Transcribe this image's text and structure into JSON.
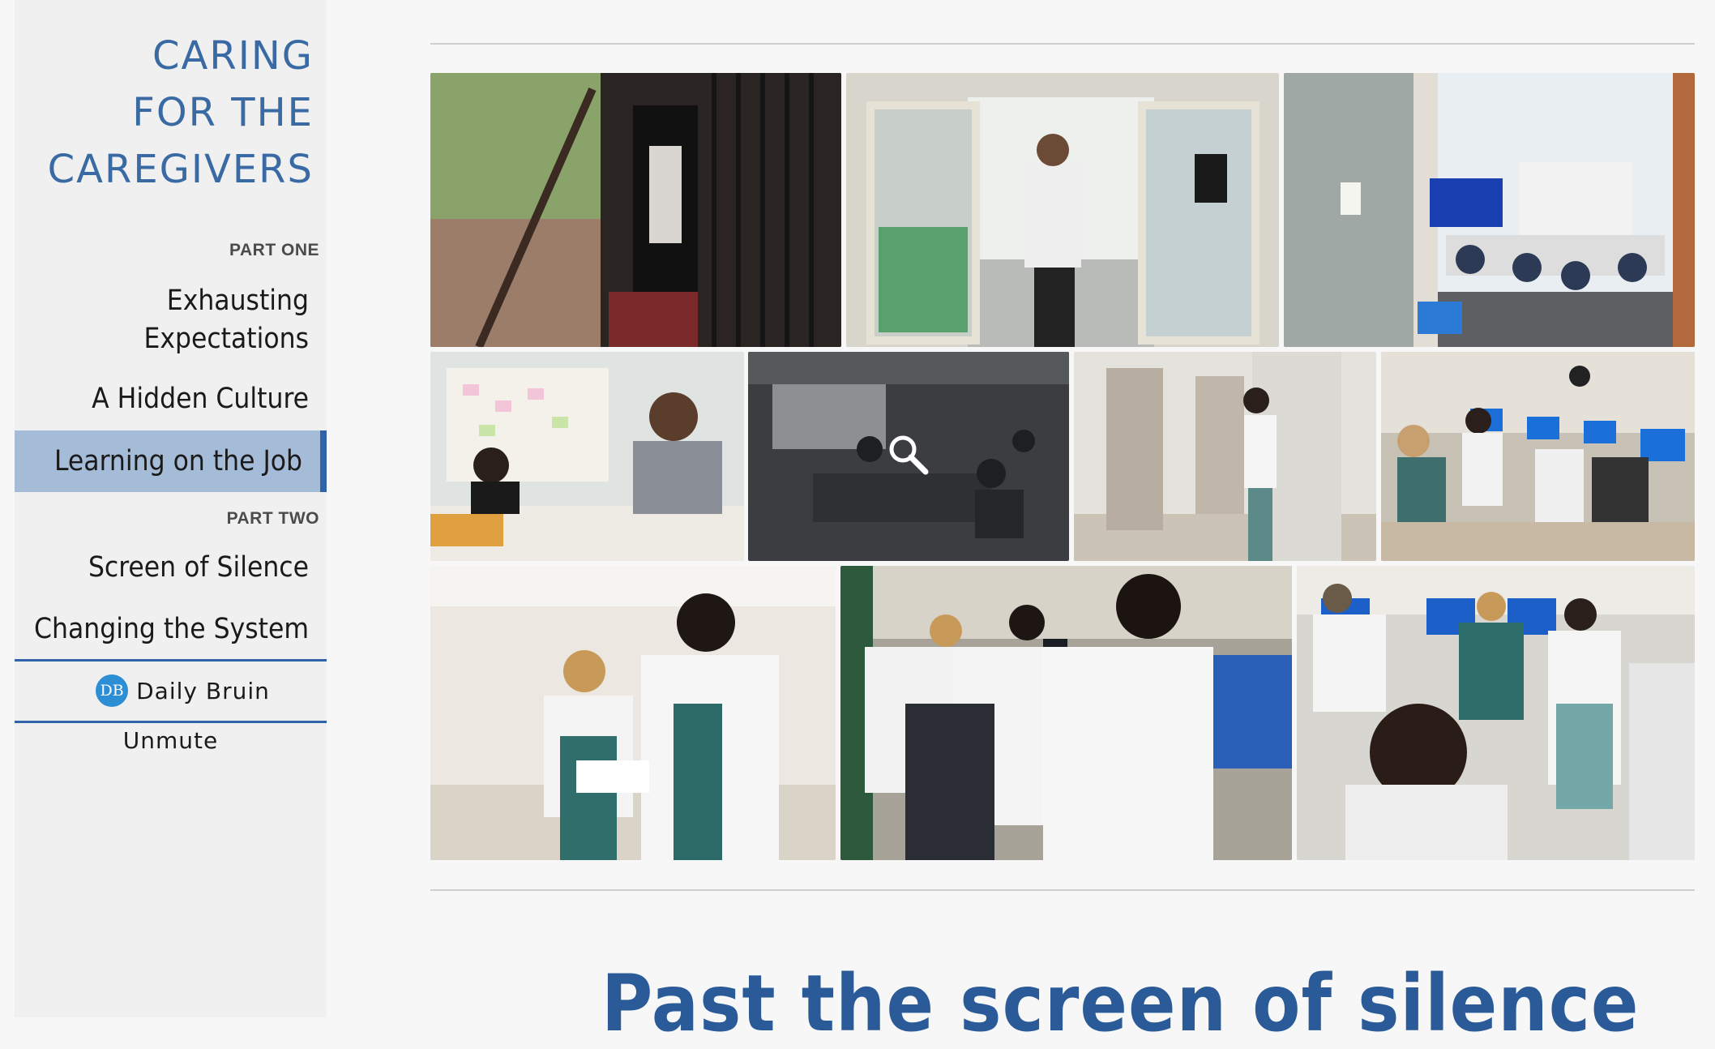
{
  "sidebar": {
    "site_title": "CARING\nFOR THE\nCAREGIVERS",
    "part_one_label": "PART ONE",
    "part_two_label": "PART TWO",
    "nav": {
      "exhausting": "Exhausting Expectations",
      "hidden_culture": "A Hidden Culture",
      "learning": "Learning on the Job",
      "screen_of_silence": "Screen of Silence",
      "changing_system": "Changing the System"
    },
    "publisher_logo_text": "DB",
    "publisher": "Daily Bruin",
    "unmute": "Unmute"
  },
  "main": {
    "headline": "Past the screen of silence"
  },
  "colors": {
    "accent": "#2f64aa",
    "active_bg": "#a5bcd9",
    "title_blue": "#3a6aa3",
    "headline_blue": "#2a5b98"
  },
  "icons": [
    "magnifier-icon"
  ]
}
